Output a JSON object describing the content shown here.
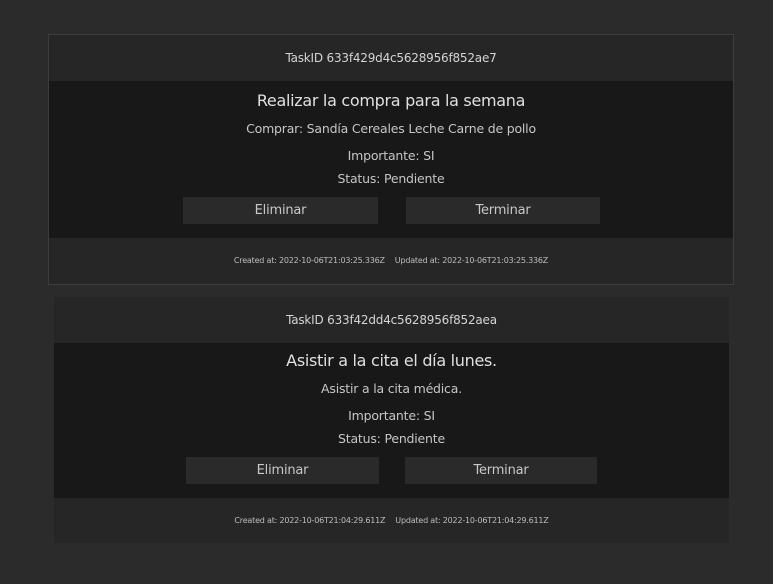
{
  "tasks": [
    {
      "task_id": "TaskID 633f429d4c5628956f852ae7",
      "title": "Realizar la compra para la semana",
      "description": "Comprar: Sandía Cereales Leche Carne de pollo",
      "important": "Importante: SI",
      "status": "Status: Pendiente",
      "delete_label": "Eliminar",
      "finish_label": "Terminar",
      "created_at": "Created at: 2022-10-06T21:03:25.336Z",
      "updated_at": "Updated at: 2022-10-06T21:03:25.336Z"
    },
    {
      "task_id": "TaskID 633f42dd4c5628956f852aea",
      "title": "Asistir a la cita el día lunes.",
      "description": "Asistir a la cita médica.",
      "important": "Importante: SI",
      "status": "Status: Pendiente",
      "delete_label": "Eliminar",
      "finish_label": "Terminar",
      "created_at": "Created at: 2022-10-06T21:04:29.611Z",
      "updated_at": "Updated at: 2022-10-06T21:04:29.611Z"
    }
  ]
}
